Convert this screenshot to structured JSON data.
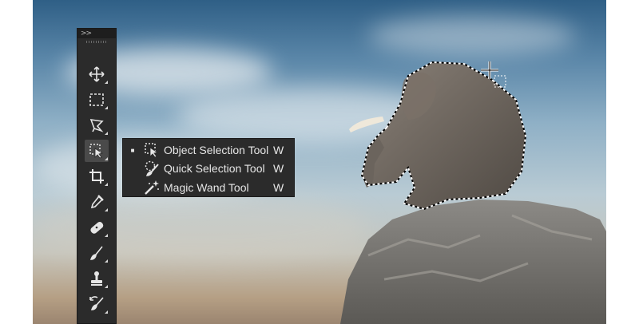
{
  "toolbar": {
    "collapse_glyph": ">>",
    "tools": [
      {
        "name": "move-tool",
        "icon": "move-icon"
      },
      {
        "name": "rectangular-marquee-tool",
        "icon": "marquee-icon"
      },
      {
        "name": "lasso-tool",
        "icon": "lasso-icon"
      },
      {
        "name": "object-selection-tool",
        "icon": "object-selection-icon",
        "active": true
      },
      {
        "name": "crop-tool",
        "icon": "crop-icon"
      },
      {
        "name": "eyedropper-tool",
        "icon": "eyedropper-icon"
      },
      {
        "name": "healing-brush-tool",
        "icon": "bandage-icon"
      },
      {
        "name": "brush-tool",
        "icon": "brush-icon"
      },
      {
        "name": "clone-stamp-tool",
        "icon": "stamp-icon"
      },
      {
        "name": "history-brush-tool",
        "icon": "history-brush-icon"
      }
    ]
  },
  "flyout": {
    "items": [
      {
        "label": "Object Selection Tool",
        "shortcut": "W",
        "selected_mark": "■",
        "icon": "object-selection-icon"
      },
      {
        "label": "Quick Selection Tool",
        "shortcut": "W",
        "selected_mark": "",
        "icon": "quick-selection-icon"
      },
      {
        "label": "Magic Wand Tool",
        "shortcut": "W",
        "selected_mark": "",
        "icon": "magic-wand-icon"
      }
    ]
  },
  "colors": {
    "panel_bg": "#2b2b2b",
    "active_tool_bg": "#4a4a4a",
    "icon_color": "#e6e6e6"
  }
}
